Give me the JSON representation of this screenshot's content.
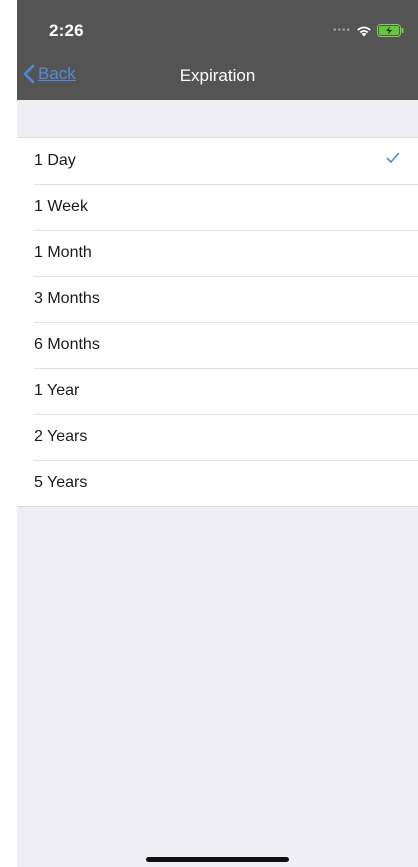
{
  "status_bar": {
    "time": "2:26",
    "signal_icon": "signal-dots-icon",
    "wifi_icon": "wifi-icon",
    "battery_icon": "battery-charging-icon"
  },
  "nav": {
    "back_label": "Back",
    "title": "Expiration"
  },
  "options": [
    {
      "label": "1 Day",
      "selected": true
    },
    {
      "label": "1 Week",
      "selected": false
    },
    {
      "label": "1 Month",
      "selected": false
    },
    {
      "label": "3 Months",
      "selected": false
    },
    {
      "label": "6 Months",
      "selected": false
    },
    {
      "label": "1 Year",
      "selected": false
    },
    {
      "label": "2 Years",
      "selected": false
    },
    {
      "label": "5 Years",
      "selected": false
    }
  ],
  "colors": {
    "nav_bar": "#545454",
    "accent": "#4e8ad8",
    "background": "#efeef4"
  }
}
